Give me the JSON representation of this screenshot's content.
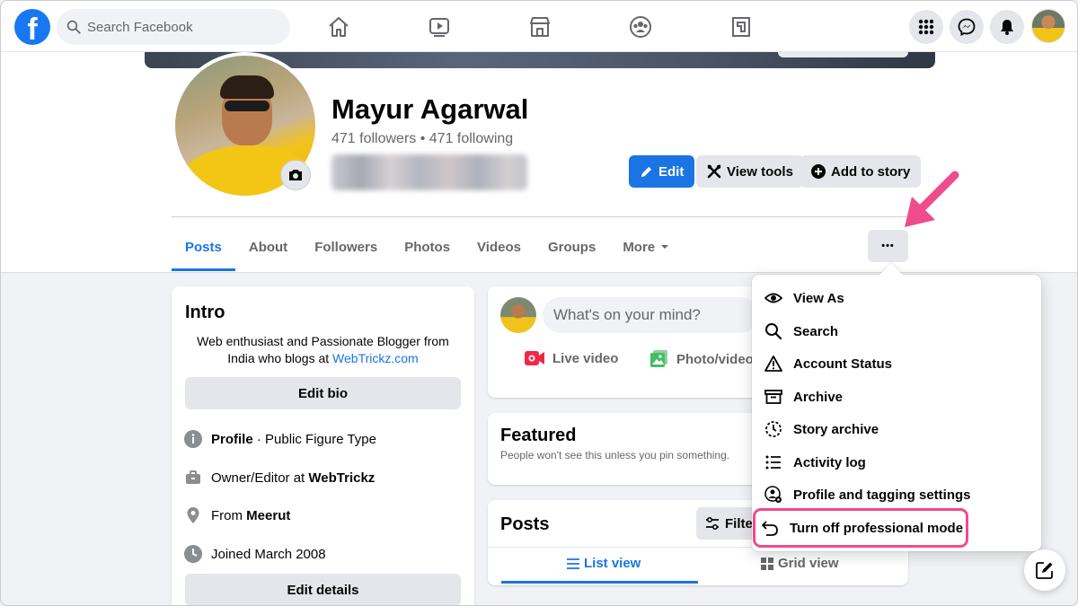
{
  "header": {
    "logo": "f",
    "search_placeholder": "Search Facebook"
  },
  "profile": {
    "name": "Mayur Agarwal",
    "followers": "471 followers • 471 following",
    "edit_label": "Edit",
    "view_tools_label": "View tools",
    "add_story_label": "Add to story",
    "more_dots": "•••"
  },
  "tabs": [
    {
      "label": "Posts"
    },
    {
      "label": "About"
    },
    {
      "label": "Followers"
    },
    {
      "label": "Photos"
    },
    {
      "label": "Videos"
    },
    {
      "label": "Groups"
    },
    {
      "label": "More"
    }
  ],
  "intro": {
    "title": "Intro",
    "bio_line": "Web enthusiast and Passionate Blogger from India who blogs at ",
    "bio_link": "WebTrickz.com",
    "edit_bio": "Edit bio",
    "profile_bold": "Profile",
    "profile_rest": " · Public Figure Type",
    "work_prefix": "Owner/Editor at ",
    "work_bold": "WebTrickz",
    "from_prefix": "From ",
    "from_bold": "Meerut",
    "joined": "Joined March 2008",
    "edit_details": "Edit details"
  },
  "composer": {
    "placeholder": "What's on your mind?",
    "live_video": "Live video",
    "photo_video": "Photo/video"
  },
  "featured": {
    "title": "Featured",
    "subtitle": "People won't see this unless you pin something."
  },
  "posts": {
    "title": "Posts",
    "filter": "Filters",
    "list_view": "List view",
    "grid_view": "Grid view"
  },
  "menu": {
    "items": [
      {
        "label": "View As"
      },
      {
        "label": "Search"
      },
      {
        "label": "Account Status"
      },
      {
        "label": "Archive"
      },
      {
        "label": "Story archive"
      },
      {
        "label": "Activity log"
      },
      {
        "label": "Profile and tagging settings"
      },
      {
        "label": "Turn off professional mode"
      }
    ]
  },
  "colors": {
    "brand_blue": "#1b74e4",
    "highlight_pink": "#ee4c8a"
  }
}
